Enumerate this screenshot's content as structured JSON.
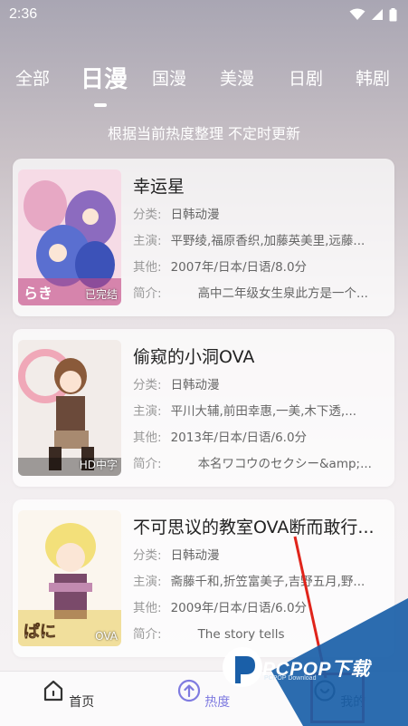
{
  "status_bar": {
    "time": "2:36"
  },
  "tabs": [
    {
      "label": "全部"
    },
    {
      "label": "日漫"
    },
    {
      "label": "国漫"
    },
    {
      "label": "美漫"
    },
    {
      "label": "日剧"
    },
    {
      "label": "韩剧"
    }
  ],
  "subtitle": "根据当前热度整理 不定时更新",
  "cards": [
    {
      "title": "幸运星",
      "badge": "已完结",
      "category_label": "分类:",
      "category": "日韩动漫",
      "cast_label": "主演:",
      "cast": "平野绫,福原香织,加藤英美里,远藤...",
      "other_label": "其他:",
      "other": "2007年/日本/日语/8.0分",
      "intro_label": "简介:",
      "intro": "高中二年级女生泉此方是一个..."
    },
    {
      "title": "偷窥的小洞OVA",
      "badge": "HD中字",
      "category_label": "分类:",
      "category": "日韩动漫",
      "cast_label": "主演:",
      "cast": "平川大辅,前田幸惠,一美,木下透,...",
      "other_label": "其他:",
      "other": "2013年/日本/日语/6.0分",
      "intro_label": "简介:",
      "intro": "本名ワコウのセクシー&amp;..."
    },
    {
      "title": "不可思议的教室OVA断而敢行...",
      "badge": "OVA",
      "category_label": "分类:",
      "category": "日韩动漫",
      "cast_label": "主演:",
      "cast": "斋藤千和,折笠富美子,吉野五月,野...",
      "other_label": "其他:",
      "other": "2009年/日本/日语/6.0分",
      "intro_label": "简介:",
      "intro": "The story tells"
    }
  ],
  "bottom_nav": [
    {
      "label": "首页",
      "icon": "home-icon"
    },
    {
      "label": "热度",
      "icon": "hot-upload-icon"
    },
    {
      "label": "我的",
      "icon": "profile-icon"
    }
  ],
  "watermark": {
    "text": "PCPOP下载",
    "sub": "PCPOP Download"
  },
  "colors": {
    "accent": "#7f7be0",
    "annotation_red": "#e0241b",
    "watermark_blue": "#1a5fa8"
  }
}
